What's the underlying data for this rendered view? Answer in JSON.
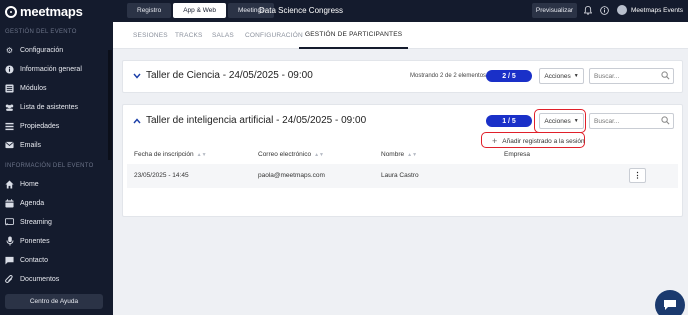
{
  "app": {
    "logo": "meetmaps"
  },
  "sidebar": {
    "section1": "GESTIÓN DEL EVENTO",
    "items1": [
      {
        "label": "Configuración",
        "icon": "gear-icon"
      },
      {
        "label": "Información general",
        "icon": "info-icon"
      },
      {
        "label": "Módulos",
        "icon": "modules-icon"
      },
      {
        "label": "Lista de asistentes",
        "icon": "users-icon"
      },
      {
        "label": "Propiedades",
        "icon": "list-icon"
      },
      {
        "label": "Emails",
        "icon": "mail-icon"
      }
    ],
    "section2": "INFORMACIÓN DEL EVENTO",
    "items2": [
      {
        "label": "Home",
        "icon": "home-icon"
      },
      {
        "label": "Agenda",
        "icon": "calendar-icon"
      },
      {
        "label": "Streaming",
        "icon": "streaming-icon"
      },
      {
        "label": "Ponentes",
        "icon": "microphone-icon"
      },
      {
        "label": "Contacto",
        "icon": "chat-icon"
      },
      {
        "label": "Documentos",
        "icon": "clip-icon"
      }
    ],
    "help": "Centro de Ayuda"
  },
  "topbar": {
    "nav": [
      "Registro",
      "App & Web",
      "Meetings"
    ],
    "active_nav": "App & Web",
    "event_title": "Data Science Congress",
    "preview": "Previsualizar",
    "user": "Meetmaps Events"
  },
  "tabs": [
    "SESIONES",
    "TRACKS",
    "SALAS",
    "CONFIGURACIÓN",
    "GESTIÓN DE PARTICIPANTES"
  ],
  "active_tab": "GESTIÓN DE PARTICIPANTES",
  "sessions": [
    {
      "title": "Taller de Ciencia - 24/05/2025 - 09:00",
      "count_text": "Mostrando 2 de 2 elementos",
      "pill": "2 / 5",
      "actions": "Acciones",
      "search_placeholder": "Buscar..."
    },
    {
      "title": "Taller de inteligencia artificial - 24/05/2025 - 09:00",
      "pill": "1 / 5",
      "actions": "Acciones",
      "search_placeholder": "Buscar...",
      "dropdown": {
        "add_label": "Añadir registrado a la sesión"
      },
      "table": {
        "columns": [
          "Fecha de inscripción",
          "Correo electrónico",
          "Nombre",
          "Empresa"
        ],
        "rows": [
          {
            "date": "23/05/2025 - 14:45",
            "email": "paola@meetmaps.com",
            "name": "Laura Castro",
            "company": ""
          }
        ]
      }
    }
  ],
  "colors": {
    "sidebar_bg": "#141b2d",
    "accent": "#1a30c8",
    "highlight": "#e0202a"
  }
}
